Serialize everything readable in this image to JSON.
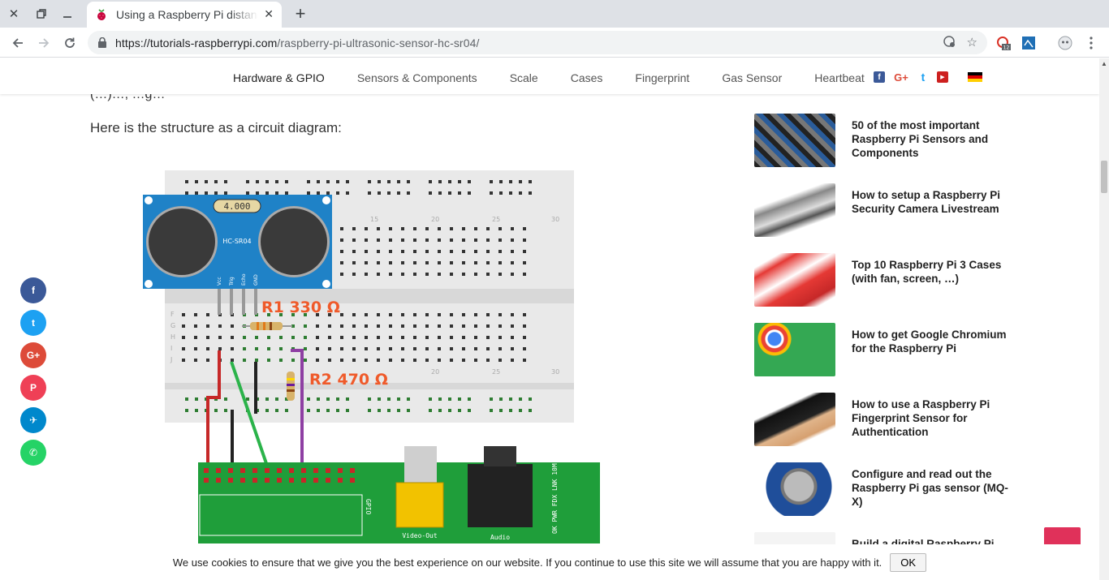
{
  "browser": {
    "tab_title": "Using a Raspberry Pi distance sensor",
    "url_host": "https://tutorials-raspberrypi.com",
    "url_path": "/raspberry-pi-ultrasonic-sensor-hc-sr04/",
    "ext_badge": "12"
  },
  "nav": {
    "items": [
      "Hardware & GPIO",
      "Sensors & Components",
      "Scale",
      "Cases",
      "Fingerprint",
      "Gas Sensor",
      "Heartbeat"
    ],
    "social": [
      "f",
      "G+",
      "t",
      "▶"
    ]
  },
  "article": {
    "partial_line": "(…)…, …g…",
    "lead": "Here is the structure as a circuit diagram:"
  },
  "diagram": {
    "sensor_label": "HC-SR04",
    "sensor_display": "4.000",
    "pins": [
      "Vcc",
      "Trig",
      "Echo",
      "GND"
    ],
    "r1": "R1 330 Ω",
    "r2": "R2 470 Ω",
    "col_numbers": [
      "15",
      "20",
      "25",
      "30"
    ],
    "row_letters": [
      "F",
      "G",
      "H",
      "I",
      "J"
    ],
    "pi_video": "Video-Out",
    "pi_audio": "Audio",
    "pi_gpio": "GPIO",
    "pi_leds": "OK PWR FDX LNK 10M"
  },
  "sidebar": {
    "posts": [
      {
        "title": "50 of the most important Raspberry Pi Sensors and Components"
      },
      {
        "title": "How to setup a Raspberry Pi Security Camera Livestream"
      },
      {
        "title": "Top 10 Raspberry Pi 3 Cases (with fan, screen, …)"
      },
      {
        "title": "How to get Google Chromium for the Raspberry Pi"
      },
      {
        "title": "How to use a Raspberry Pi Fingerprint Sensor for Authentication"
      },
      {
        "title": "Configure and read out the Raspberry Pi gas sensor (MQ-X)"
      },
      {
        "title": "Build a digital Raspberry Pi"
      }
    ]
  },
  "share": [
    "f",
    "t",
    "G+",
    "P",
    "✈",
    "✆"
  ],
  "cookie": {
    "text": "We use cookies to ensure that we give you the best experience on our website. If you continue to use this site we will assume that you are happy with it.",
    "ok": "OK"
  }
}
